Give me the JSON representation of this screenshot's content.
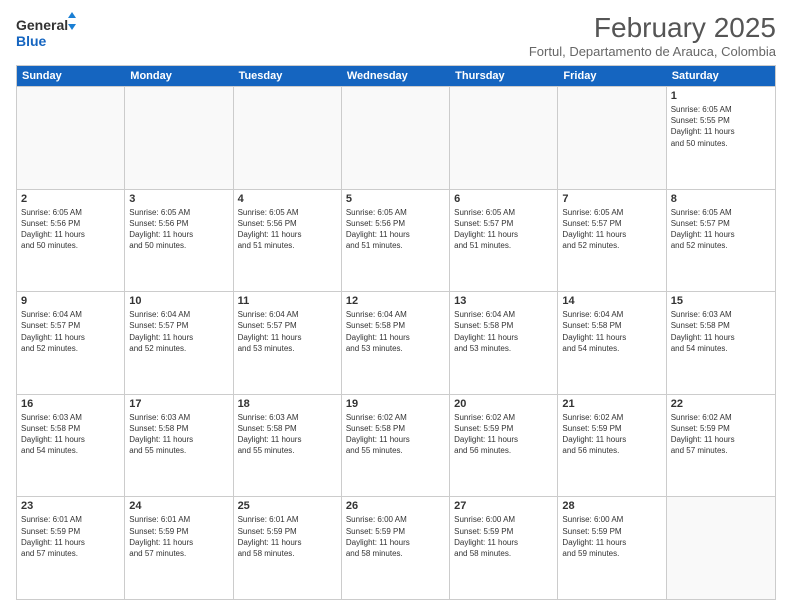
{
  "logo": {
    "line1": "General",
    "line2": "Blue"
  },
  "title": "February 2025",
  "location": "Fortul, Departamento de Arauca, Colombia",
  "days_of_week": [
    "Sunday",
    "Monday",
    "Tuesday",
    "Wednesday",
    "Thursday",
    "Friday",
    "Saturday"
  ],
  "weeks": [
    [
      {
        "day": "",
        "info": ""
      },
      {
        "day": "",
        "info": ""
      },
      {
        "day": "",
        "info": ""
      },
      {
        "day": "",
        "info": ""
      },
      {
        "day": "",
        "info": ""
      },
      {
        "day": "",
        "info": ""
      },
      {
        "day": "1",
        "info": "Sunrise: 6:05 AM\nSunset: 5:55 PM\nDaylight: 11 hours\nand 50 minutes."
      }
    ],
    [
      {
        "day": "2",
        "info": "Sunrise: 6:05 AM\nSunset: 5:56 PM\nDaylight: 11 hours\nand 50 minutes."
      },
      {
        "day": "3",
        "info": "Sunrise: 6:05 AM\nSunset: 5:56 PM\nDaylight: 11 hours\nand 50 minutes."
      },
      {
        "day": "4",
        "info": "Sunrise: 6:05 AM\nSunset: 5:56 PM\nDaylight: 11 hours\nand 51 minutes."
      },
      {
        "day": "5",
        "info": "Sunrise: 6:05 AM\nSunset: 5:56 PM\nDaylight: 11 hours\nand 51 minutes."
      },
      {
        "day": "6",
        "info": "Sunrise: 6:05 AM\nSunset: 5:57 PM\nDaylight: 11 hours\nand 51 minutes."
      },
      {
        "day": "7",
        "info": "Sunrise: 6:05 AM\nSunset: 5:57 PM\nDaylight: 11 hours\nand 52 minutes."
      },
      {
        "day": "8",
        "info": "Sunrise: 6:05 AM\nSunset: 5:57 PM\nDaylight: 11 hours\nand 52 minutes."
      }
    ],
    [
      {
        "day": "9",
        "info": "Sunrise: 6:04 AM\nSunset: 5:57 PM\nDaylight: 11 hours\nand 52 minutes."
      },
      {
        "day": "10",
        "info": "Sunrise: 6:04 AM\nSunset: 5:57 PM\nDaylight: 11 hours\nand 52 minutes."
      },
      {
        "day": "11",
        "info": "Sunrise: 6:04 AM\nSunset: 5:57 PM\nDaylight: 11 hours\nand 53 minutes."
      },
      {
        "day": "12",
        "info": "Sunrise: 6:04 AM\nSunset: 5:58 PM\nDaylight: 11 hours\nand 53 minutes."
      },
      {
        "day": "13",
        "info": "Sunrise: 6:04 AM\nSunset: 5:58 PM\nDaylight: 11 hours\nand 53 minutes."
      },
      {
        "day": "14",
        "info": "Sunrise: 6:04 AM\nSunset: 5:58 PM\nDaylight: 11 hours\nand 54 minutes."
      },
      {
        "day": "15",
        "info": "Sunrise: 6:03 AM\nSunset: 5:58 PM\nDaylight: 11 hours\nand 54 minutes."
      }
    ],
    [
      {
        "day": "16",
        "info": "Sunrise: 6:03 AM\nSunset: 5:58 PM\nDaylight: 11 hours\nand 54 minutes."
      },
      {
        "day": "17",
        "info": "Sunrise: 6:03 AM\nSunset: 5:58 PM\nDaylight: 11 hours\nand 55 minutes."
      },
      {
        "day": "18",
        "info": "Sunrise: 6:03 AM\nSunset: 5:58 PM\nDaylight: 11 hours\nand 55 minutes."
      },
      {
        "day": "19",
        "info": "Sunrise: 6:02 AM\nSunset: 5:58 PM\nDaylight: 11 hours\nand 55 minutes."
      },
      {
        "day": "20",
        "info": "Sunrise: 6:02 AM\nSunset: 5:59 PM\nDaylight: 11 hours\nand 56 minutes."
      },
      {
        "day": "21",
        "info": "Sunrise: 6:02 AM\nSunset: 5:59 PM\nDaylight: 11 hours\nand 56 minutes."
      },
      {
        "day": "22",
        "info": "Sunrise: 6:02 AM\nSunset: 5:59 PM\nDaylight: 11 hours\nand 57 minutes."
      }
    ],
    [
      {
        "day": "23",
        "info": "Sunrise: 6:01 AM\nSunset: 5:59 PM\nDaylight: 11 hours\nand 57 minutes."
      },
      {
        "day": "24",
        "info": "Sunrise: 6:01 AM\nSunset: 5:59 PM\nDaylight: 11 hours\nand 57 minutes."
      },
      {
        "day": "25",
        "info": "Sunrise: 6:01 AM\nSunset: 5:59 PM\nDaylight: 11 hours\nand 58 minutes."
      },
      {
        "day": "26",
        "info": "Sunrise: 6:00 AM\nSunset: 5:59 PM\nDaylight: 11 hours\nand 58 minutes."
      },
      {
        "day": "27",
        "info": "Sunrise: 6:00 AM\nSunset: 5:59 PM\nDaylight: 11 hours\nand 58 minutes."
      },
      {
        "day": "28",
        "info": "Sunrise: 6:00 AM\nSunset: 5:59 PM\nDaylight: 11 hours\nand 59 minutes."
      },
      {
        "day": "",
        "info": ""
      }
    ]
  ]
}
